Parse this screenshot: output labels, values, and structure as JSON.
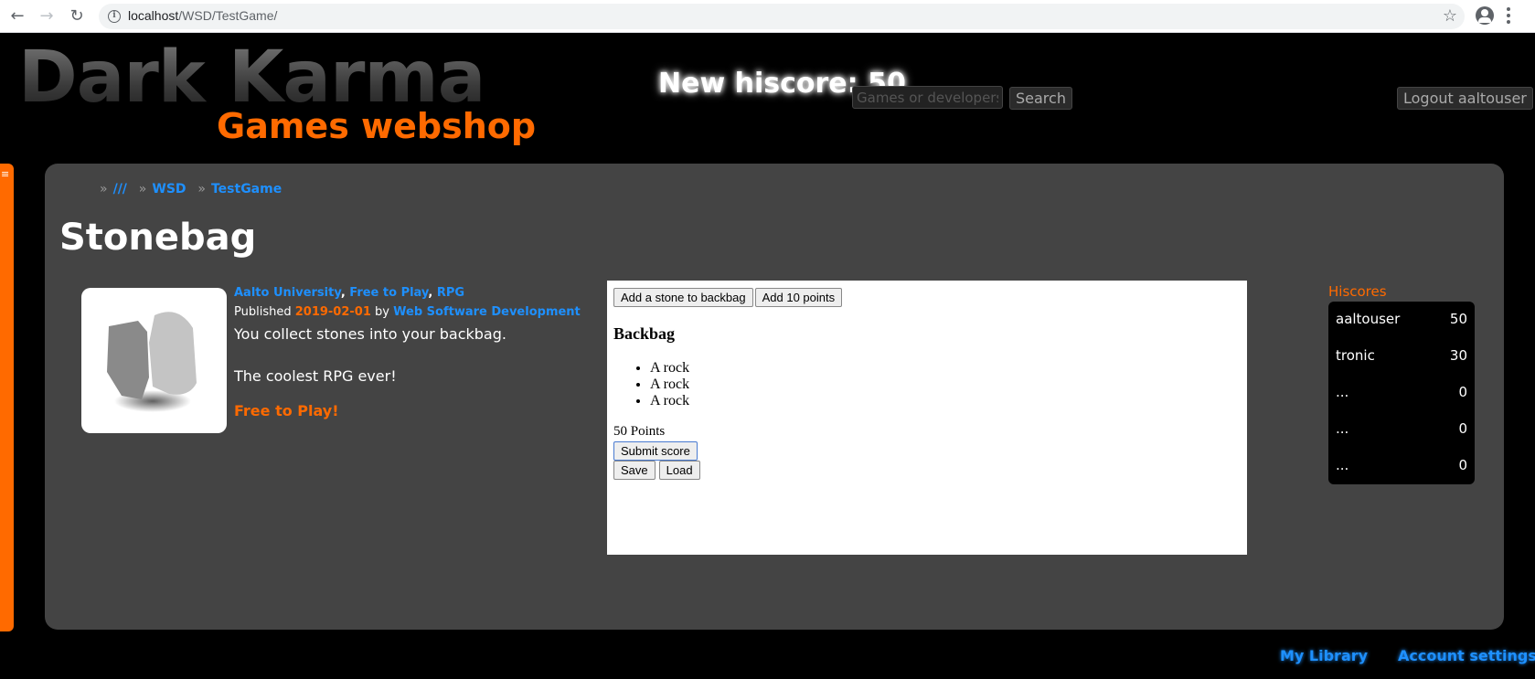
{
  "browser": {
    "url_host": "localhost",
    "url_path": "/WSD/TestGame/"
  },
  "header": {
    "logo_main": "Dark Karma",
    "logo_sub": "Games webshop",
    "hiscore_banner": "New hiscore: 50",
    "search_placeholder": "Games or developers",
    "search_button": "Search",
    "logout_button": "Logout aaltouser"
  },
  "side_tab": {
    "icon": "≡"
  },
  "breadcrumb": {
    "items": [
      "///",
      "WSD",
      "TestGame"
    ],
    "separator": "»"
  },
  "game": {
    "title": "Stonebag",
    "tags": [
      "Aalto University",
      "Free to Play",
      "RPG"
    ],
    "published_label": "Published",
    "published_date": "2019-02-01",
    "by_label": "by",
    "developer": "Web Software Development",
    "description_1": "You collect stones into your backbag.",
    "description_2": "The coolest RPG ever!",
    "free_link": "Free to Play!"
  },
  "frame": {
    "add_stone_button": "Add a stone to backbag",
    "add_points_button": "Add 10 points",
    "heading": "Backbag",
    "items": [
      "A rock",
      "A rock",
      "A rock"
    ],
    "points_text": "50 Points",
    "submit_button": "Submit score",
    "save_button": "Save",
    "load_button": "Load"
  },
  "hiscores": {
    "title": "Hiscores",
    "rows": [
      {
        "name": "aaltouser",
        "score": "50"
      },
      {
        "name": "tronic",
        "score": "30"
      },
      {
        "name": "...",
        "score": "0"
      },
      {
        "name": "...",
        "score": "0"
      },
      {
        "name": "...",
        "score": "0"
      }
    ]
  },
  "footer": {
    "my_library": "My Library",
    "account_settings": "Account settings"
  }
}
